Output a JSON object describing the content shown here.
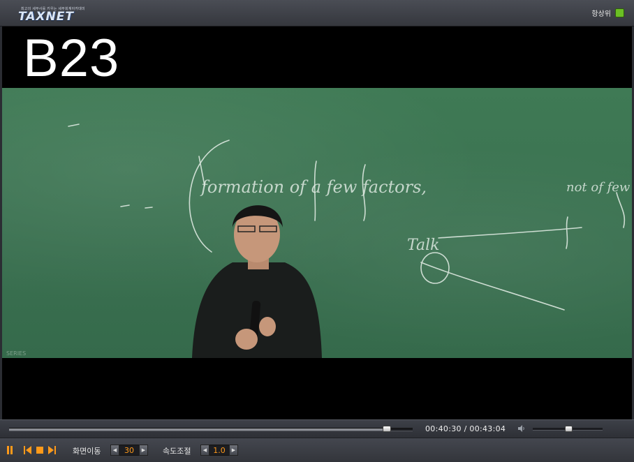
{
  "titlebar": {
    "logo_text": "TAXNET",
    "logo_tagline": "최고의 세무사를 키우는 세무회계아카데미",
    "always_on_top_label": "항상위",
    "always_on_top_checked": true,
    "accent_color": "#6bbf24"
  },
  "video": {
    "overlay_label": "B23",
    "board_text": [
      "formation of a few factors,",
      "not of few",
      "Talk"
    ],
    "corner_watermark": "SERIES"
  },
  "seekbar": {
    "progress": 0.935,
    "time_display": "00:40:30 / 00:43:04",
    "volume": 0.51
  },
  "controls": {
    "buttons": [
      "pause-icon",
      "previous-icon",
      "stop-icon",
      "next-icon"
    ],
    "screen_move_label": "화면이동",
    "screen_move_value": "30",
    "speed_label": "속도조절",
    "speed_value": "1.0"
  }
}
